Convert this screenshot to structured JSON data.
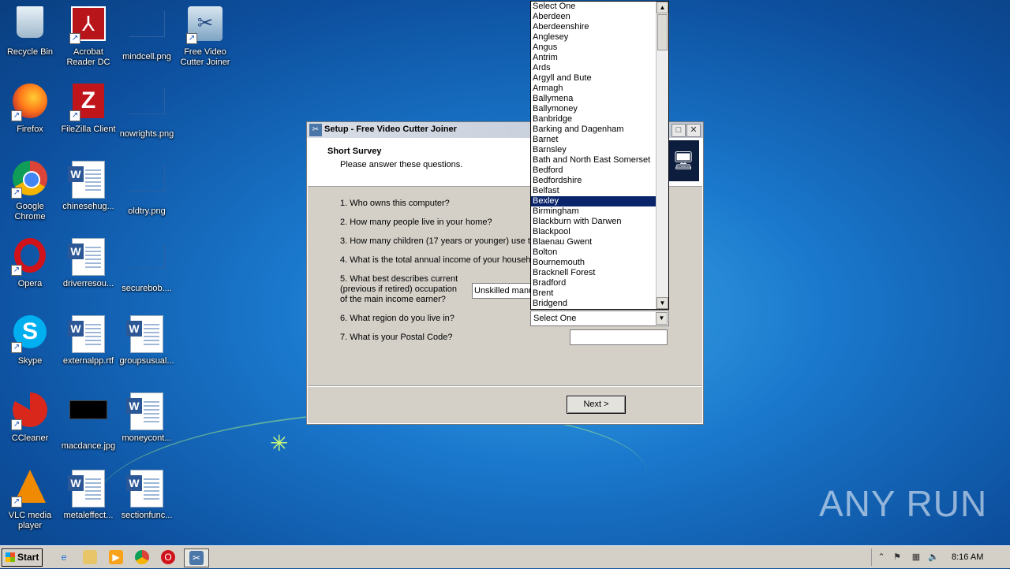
{
  "desktop": {
    "icons": [
      {
        "label": "Recycle Bin"
      },
      {
        "label": "Acrobat Reader DC"
      },
      {
        "label": "mindcell.png"
      },
      {
        "label": "Free Video Cutter Joiner"
      },
      {
        "label": "Firefox"
      },
      {
        "label": "FileZilla Client"
      },
      {
        "label": "nowrights.png"
      },
      {
        "label": "Google Chrome"
      },
      {
        "label": "chinesehug..."
      },
      {
        "label": "oldtry.png"
      },
      {
        "label": "Opera"
      },
      {
        "label": "driverresou..."
      },
      {
        "label": "securebob...."
      },
      {
        "label": "Skype"
      },
      {
        "label": "externalpp.rtf"
      },
      {
        "label": "groupsusual..."
      },
      {
        "label": "CCleaner"
      },
      {
        "label": "macdance.jpg"
      },
      {
        "label": "moneycont..."
      },
      {
        "label": "VLC media player"
      },
      {
        "label": "metaleffect..."
      },
      {
        "label": "sectionfunc..."
      }
    ]
  },
  "window": {
    "title": "Setup - Free Video Cutter Joiner",
    "header_title": "Short Survey",
    "header_subtitle": "Please answer these questions.",
    "questions": [
      "1. Who owns this computer?",
      "2. How many people live in your home?",
      "3. How many children (17 years or younger) use th",
      "4. What is the total annual income of your househo",
      "5. What best describes current (previous if retired) occupation of the main income earner?",
      "6. What region do you live in?",
      "7. What is your Postal Code?"
    ],
    "q5_lines": [
      "5. What best describes current",
      "(previous if retired) occupation",
      "of the main income earner?"
    ],
    "occupation_value": "Unskilled manual",
    "region_value": "Select One",
    "postal_value": "",
    "next_label": "Next >"
  },
  "region_dropdown": {
    "selected": "Bexley",
    "options": [
      "Select One",
      "Aberdeen",
      "Aberdeenshire",
      "Anglesey",
      "Angus",
      "Antrim",
      "Ards",
      "Argyll and Bute",
      "Armagh",
      "Ballymena",
      "Ballymoney",
      "Banbridge",
      "Barking and Dagenham",
      "Barnet",
      "Barnsley",
      "Bath and North East Somerset",
      "Bedford",
      "Bedfordshire",
      "Belfast",
      "Bexley",
      "Birmingham",
      "Blackburn with Darwen",
      "Blackpool",
      "Blaenau Gwent",
      "Bolton",
      "Bournemouth",
      "Bracknell Forest",
      "Bradford",
      "Brent",
      "Bridgend"
    ]
  },
  "watermark": "ANY RUN",
  "taskbar": {
    "start_label": "Start",
    "clock": "8:16 AM"
  }
}
